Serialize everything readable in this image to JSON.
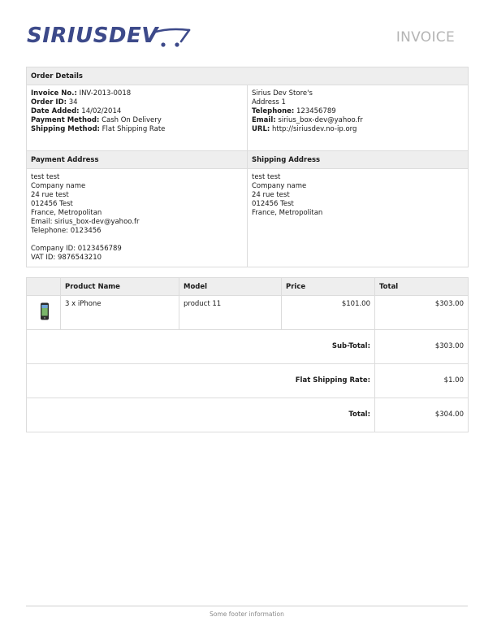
{
  "brand": {
    "logo_text": "SIRIUSDEV"
  },
  "invoice_title": "INVOICE",
  "order_details": {
    "heading": "Order Details",
    "invoice_no_label": "Invoice No.:",
    "invoice_no": "INV-2013-0018",
    "order_id_label": "Order ID:",
    "order_id": "34",
    "date_added_label": "Date Added:",
    "date_added": "14/02/2014",
    "payment_method_label": "Payment Method:",
    "payment_method": "Cash On Delivery",
    "shipping_method_label": "Shipping Method:",
    "shipping_method": "Flat Shipping Rate"
  },
  "store": {
    "name": "Sirius Dev Store's",
    "address": "Address 1",
    "telephone_label": "Telephone:",
    "telephone": "123456789",
    "email_label": "Email:",
    "email": "sirius_box-dev@yahoo.fr",
    "url_label": "URL:",
    "url": "http://siriusdev.no-ip.org"
  },
  "payment_address": {
    "heading": "Payment Address",
    "lines": [
      "test test",
      "Company name",
      "24 rue test",
      "012456 Test",
      "France, Metropolitan",
      "Email: sirius_box-dev@yahoo.fr",
      "Telephone: 0123456"
    ],
    "company_id": "Company ID: 0123456789",
    "vat_id": "VAT ID: 9876543210"
  },
  "shipping_address": {
    "heading": "Shipping Address",
    "lines": [
      "test test",
      "Company name",
      "24 rue test",
      "012456 Test",
      "France, Metropolitan"
    ]
  },
  "products": {
    "headers": {
      "name": "Product Name",
      "model": "Model",
      "price": "Price",
      "total": "Total"
    },
    "items": [
      {
        "image": "phone-icon",
        "name": "3 x iPhone",
        "model": "product 11",
        "price": "$101.00",
        "total": "$303.00"
      }
    ]
  },
  "totals": [
    {
      "label": "Sub-Total:",
      "value": "$303.00"
    },
    {
      "label": "Flat Shipping Rate:",
      "value": "$1.00"
    },
    {
      "label": "Total:",
      "value": "$304.00"
    }
  ],
  "footer": "Some footer information",
  "colors": {
    "logo": "#3d4a8a",
    "header_bg": "#eeeeee",
    "border": "#dcdcdc",
    "title": "#b4b4b4"
  }
}
